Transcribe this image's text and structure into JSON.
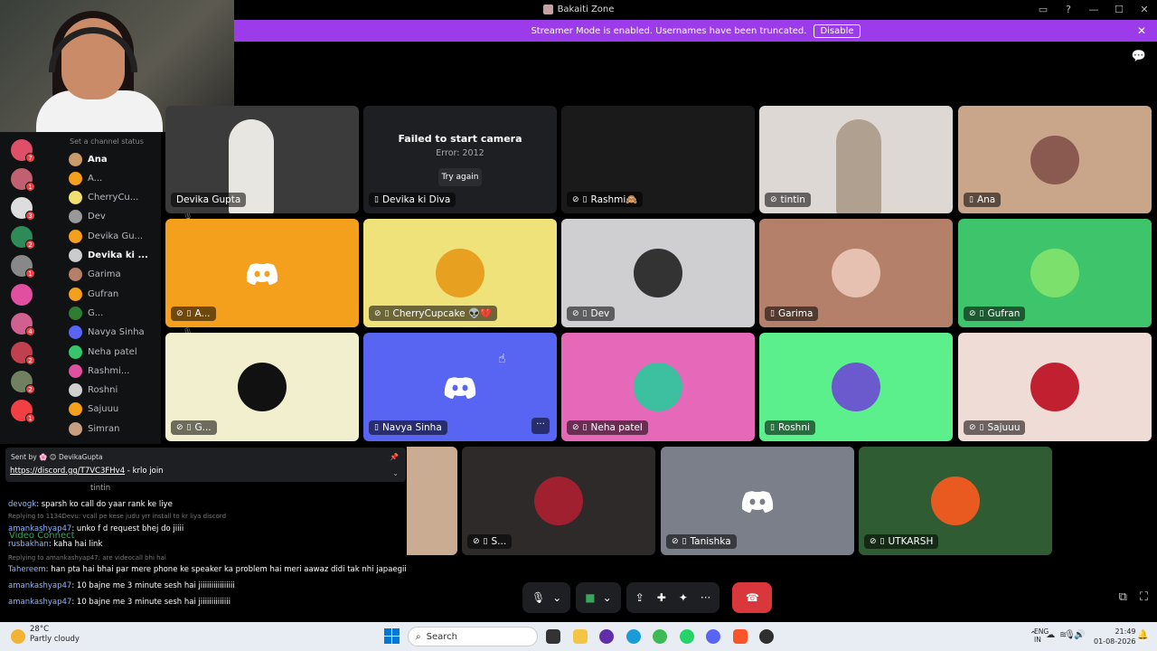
{
  "window": {
    "title": "Bakaiti Zone",
    "controls": [
      "▭",
      "?",
      "—",
      "☐",
      "✕"
    ]
  },
  "banner": {
    "text": "Streamer Mode is enabled. Usernames have been truncated.",
    "button": "Disable"
  },
  "sidebar": {
    "status_text": "Set a channel status",
    "members": [
      {
        "name": "Ana",
        "color": "#c99a6b",
        "bold": true,
        "mic": ""
      },
      {
        "name": "A...",
        "color": "#f4a01c",
        "bold": false,
        "mic": "🎙"
      },
      {
        "name": "CherryCu...",
        "color": "#f0e070",
        "bold": false,
        "mic": "🎙"
      },
      {
        "name": "Dev",
        "color": "#999",
        "bold": false,
        "mic": "🎙"
      },
      {
        "name": "Devika Gu...",
        "color": "#f4a01c",
        "bold": false,
        "mic": "■"
      },
      {
        "name": "Devika ki ...",
        "color": "#ccc",
        "bold": true,
        "mic": "■"
      },
      {
        "name": "Garima",
        "color": "#b5806a",
        "bold": false,
        "mic": ""
      },
      {
        "name": "Gufran",
        "color": "#f4a01c",
        "bold": false,
        "mic": "🎙"
      },
      {
        "name": "G...",
        "color": "#2e7d32",
        "bold": false,
        "mic": "🎙"
      },
      {
        "name": "Navya Sinha",
        "color": "#5865f2",
        "bold": false,
        "mic": "🎙"
      },
      {
        "name": "Neha patel",
        "color": "#36c46c",
        "bold": false,
        "mic": "🎙"
      },
      {
        "name": "Rashmi...",
        "color": "#e04fa0",
        "bold": false,
        "mic": "■"
      },
      {
        "name": "Roshni",
        "color": "#d0d0d0",
        "bold": false,
        "mic": ""
      },
      {
        "name": "Sajuuu",
        "color": "#f4a01c",
        "bold": false,
        "mic": "🎙"
      },
      {
        "name": "Simran",
        "color": "#c8a080",
        "bold": false,
        "mic": "🎙"
      }
    ],
    "rail_badges": [
      "7",
      "1",
      "3",
      "2",
      "1",
      "",
      "4",
      "2",
      "2",
      "1"
    ]
  },
  "tiles": [
    {
      "name": "Devika Gupta",
      "bg": "#3b3b3b"
    },
    {
      "name": "Devika ki Diva",
      "bg": "#1e1f22",
      "error_title": "Failed to start camera",
      "error_code": "Error: 2012",
      "button": "Try again"
    },
    {
      "name": "Rashmi🙈",
      "bg": "#1a1a1a"
    },
    {
      "name": "tintin",
      "bg": "#ddd8d4"
    },
    {
      "name": "Ana",
      "bg": "#c9a58a"
    },
    {
      "name": "A...",
      "bg": "#f4a01c"
    },
    {
      "name": "CherryCupcake 👽💔",
      "bg": "#f0e27a"
    },
    {
      "name": "Dev",
      "bg": "#cfcfd2"
    },
    {
      "name": "Garima",
      "bg": "#b5806a"
    },
    {
      "name": "Gufran",
      "bg": "#3ec46a"
    },
    {
      "name": "G...",
      "bg": "#f2efcf"
    },
    {
      "name": "Navya Sinha",
      "bg": "#5865f2"
    },
    {
      "name": "Neha patel",
      "bg": "#e668b8"
    },
    {
      "name": "Roshni",
      "bg": "#5cf08c"
    },
    {
      "name": "Sajuuu",
      "bg": "#efdcd6"
    },
    {
      "name": "Simran",
      "bg": "#c9ac92"
    },
    {
      "name": "S...",
      "bg": "#2e2a2a"
    },
    {
      "name": "Tanishka",
      "bg": "#7a7f8a"
    },
    {
      "name": "UTKARSH",
      "bg": "#2f5c33"
    }
  ],
  "chat": {
    "pinned_sender": "Sent by 🌸 😊 DevikaGupta",
    "pinned_link": "https://discord.gg/T7VC3FHv4",
    "pinned_suffix": " - krlo join",
    "overlay_user": "tintin",
    "lines": [
      {
        "user": "devogk",
        "text": ": sparsh ko call do yaar rank ke liye",
        "dim": false
      },
      {
        "user": "",
        "text": "Replying to 1134Devu: vcall pe kese judu yrr install to kr liya discord",
        "dim": true
      },
      {
        "user": "amankashyap47",
        "text": ": unko f d request bhej do jiiii",
        "dim": false
      },
      {
        "user": "rusbakhan",
        "text": ": kaha hai link",
        "dim": false
      },
      {
        "user": "",
        "text": "Replying to amankashyap47: are videocall bhi hai",
        "dim": true
      },
      {
        "user": "Tahereem",
        "text": ": han pta hai bhai par mere phone ke speaker ka problem hai meri aawaz didi tak nhi japaegii",
        "dim": false
      },
      {
        "user": "amankashyap47",
        "text": ": 10 bajne me 3 minute sesh hai jiiiiiiiiiiiiiiii",
        "dim": false
      },
      {
        "user": "amankashyap47",
        "text": ": 10 bajne me 3 minute sesh hai jiiiiiiiiiiiiii",
        "dim": false
      }
    ],
    "voice_connected": "Video Connect"
  },
  "controls": {
    "mic": "🎙",
    "camera": "■",
    "screen": "⇪",
    "activities": "✚",
    "effects": "✦",
    "more": "···",
    "leave": "☎"
  },
  "taskbar": {
    "weather_temp": "28°C",
    "weather_desc": "Partly cloudy",
    "search": "Search",
    "lang1": "ENG",
    "lang2": "IN",
    "time": "21:49",
    "date": "01-08-2026"
  },
  "colors": {
    "accent": "#9c3bea",
    "leave": "#da373c",
    "blurple": "#5865f2"
  }
}
